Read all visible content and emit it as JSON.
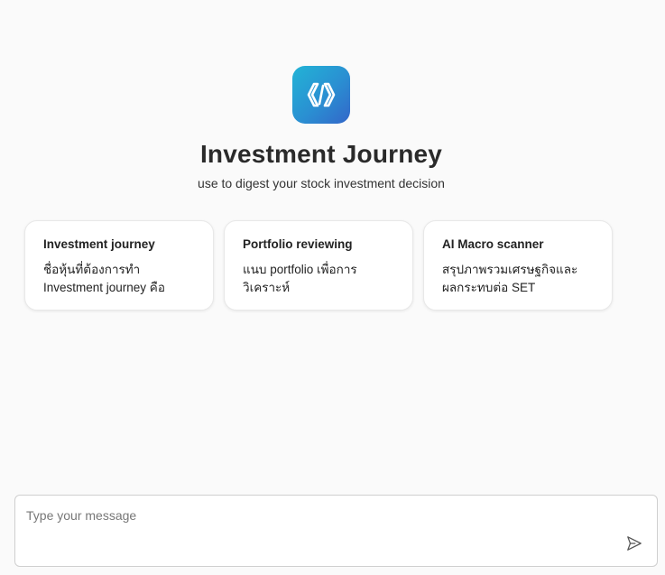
{
  "app": {
    "title": "Investment Journey",
    "subtitle": "use to digest your stock investment decision",
    "logo_icon": "code-brackets-icon",
    "brand_gradient": [
      "#22b4d6",
      "#3366c9"
    ]
  },
  "suggestions": [
    {
      "title": "Investment journey",
      "line1": "ชื่อหุ้นที่ต้องการทำ",
      "line2": "Investment journey คือ"
    },
    {
      "title": "Portfolio reviewing",
      "line1": "แนบ portfolio เพื่อการ",
      "line2": "วิเคราะห์"
    },
    {
      "title": "AI Macro scanner",
      "line1": "สรุปภาพรวมเศรษฐกิจและ",
      "line2": "ผลกระทบต่อ SET"
    }
  ],
  "composer": {
    "placeholder": "Type your message",
    "value": "",
    "send_icon": "send-icon"
  }
}
